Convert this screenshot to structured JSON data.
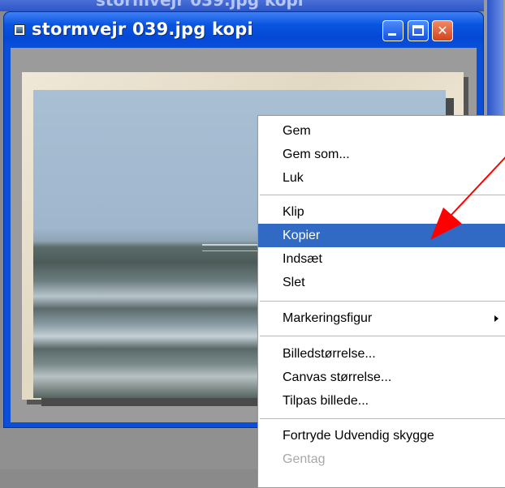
{
  "background_window": {
    "title": "stormvejr 039.jpg kopi"
  },
  "window": {
    "title": "stormvejr 039.jpg kopi",
    "buttons": {
      "minimize_icon": "minimize-icon",
      "maximize_icon": "maximize-icon",
      "close_icon": "close-icon",
      "close_glyph": "✕"
    }
  },
  "context_menu": {
    "items": [
      {
        "label": "Gem",
        "state": "normal"
      },
      {
        "label": "Gem som...",
        "state": "normal"
      },
      {
        "label": "Luk",
        "state": "normal"
      },
      {
        "label": "Klip",
        "state": "normal"
      },
      {
        "label": "Kopier",
        "state": "highlighted"
      },
      {
        "label": "Indsæt",
        "state": "normal"
      },
      {
        "label": "Slet",
        "state": "normal"
      },
      {
        "label": "Markeringsfigur",
        "state": "submenu"
      },
      {
        "label": "Billedstørrelse...",
        "state": "normal"
      },
      {
        "label": "Canvas størrelse...",
        "state": "normal"
      },
      {
        "label": "Tilpas billede...",
        "state": "normal"
      },
      {
        "label": "Fortryde Udvendig skygge",
        "state": "normal"
      },
      {
        "label": "Gentag",
        "state": "disabled"
      }
    ]
  },
  "colors": {
    "title_bar": "#0a55e0",
    "menu_highlight": "#316ac5",
    "annotation_arrow": "#ff0000"
  }
}
